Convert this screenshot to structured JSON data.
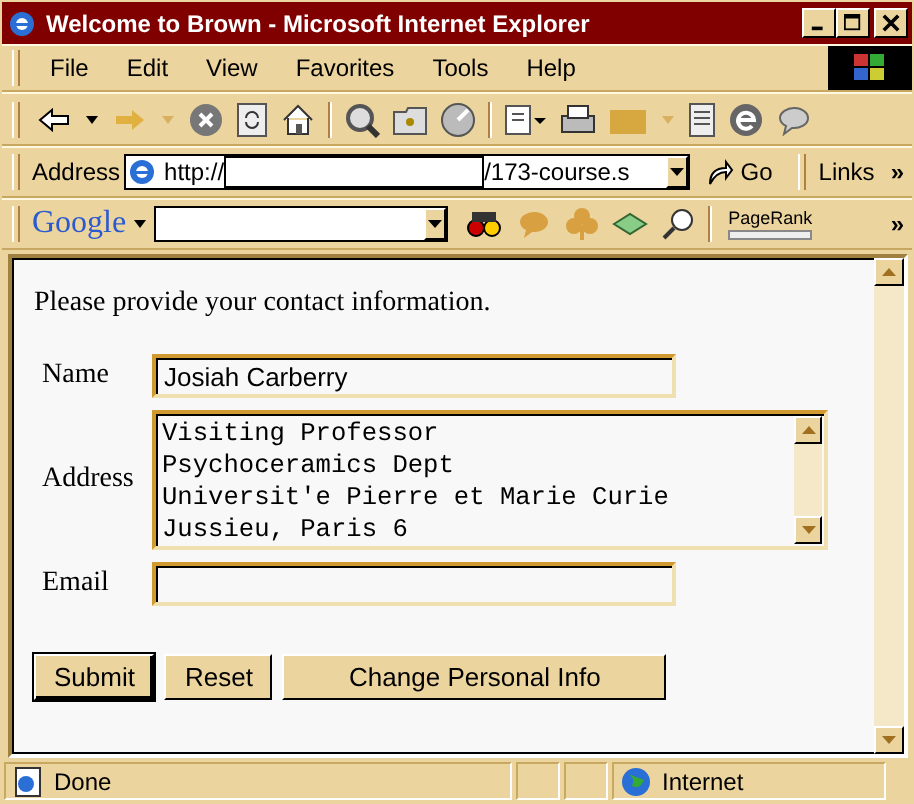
{
  "window": {
    "title": "Welcome to Brown - Microsoft Internet Explorer"
  },
  "menu": [
    "File",
    "Edit",
    "View",
    "Favorites",
    "Tools",
    "Help"
  ],
  "address_bar": {
    "label": "Address",
    "url_start": "http://",
    "url_end": "/173-course.s",
    "go": "Go",
    "links": "Links",
    "more": "»"
  },
  "google_bar": {
    "logo": "Google",
    "pagerank": "PageRank",
    "more": "»"
  },
  "form": {
    "intro": "Please provide your contact information.",
    "fields": [
      {
        "kind": "text",
        "label": "Name",
        "value": "Josiah Carberry"
      },
      {
        "kind": "textarea",
        "label": "Address",
        "value": "Visiting Professor\nPsychoceramics Dept\nUniversit'e Pierre et Marie Curie\nJussieu, Paris 6"
      },
      {
        "kind": "text",
        "label": "Email"
      }
    ],
    "buttons": [
      {
        "label": "Submit",
        "default": true
      },
      {
        "label": "Reset",
        "default": false
      },
      {
        "label": "Change Personal Info",
        "default": false
      }
    ]
  },
  "status_bar": {
    "text": "Done",
    "zone": "Internet"
  }
}
